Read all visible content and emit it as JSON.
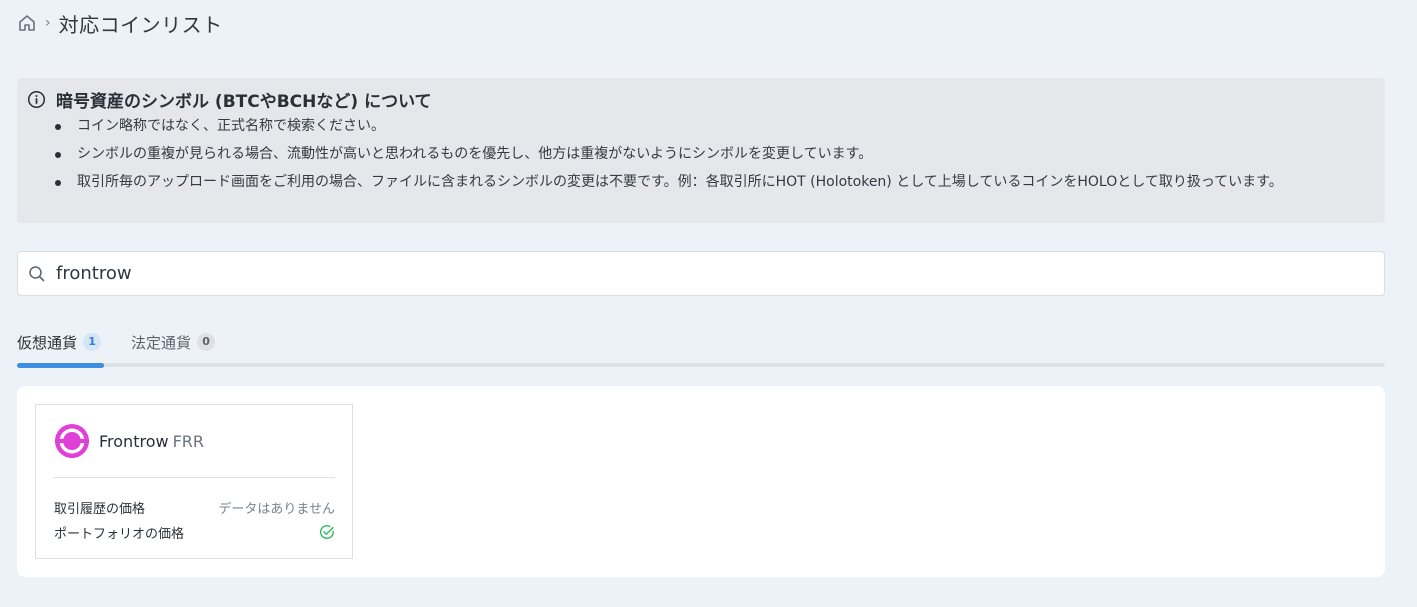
{
  "breadcrumb": {
    "home_icon": "home-icon",
    "separator": "›",
    "title": "対応コインリスト"
  },
  "info": {
    "icon": "info-icon",
    "title": "暗号資産のシンボル (BTCやBCHなど) について",
    "items": [
      "コイン略称ではなく、正式名称で検索ください。",
      "シンボルの重複が見られる場合、流動性が高いと思われるものを優先し、他方は重複がないようにシンボルを変更しています。",
      "取引所毎のアップロード画面をご利用の場合、ファイルに含まれるシンボルの変更は不要です。例：各取引所にHOT (Holotoken) として上場しているコインをHOLOとして取り扱っています。"
    ]
  },
  "search": {
    "icon": "search-icon",
    "value": "frontrow"
  },
  "tabs": [
    {
      "label": "仮想通貨",
      "count": "1",
      "active": true
    },
    {
      "label": "法定通貨",
      "count": "0",
      "active": false
    }
  ],
  "colors": {
    "background": "#edf2f8",
    "accent": "#3b8ee0",
    "coin_logo": "#e040d8",
    "success": "#2fb866"
  },
  "coin": {
    "logo_icon": "frontrow-logo-icon",
    "name": "Frontrow",
    "symbol": "FRR",
    "rows": [
      {
        "label": "取引履歴の価格",
        "value": "データはありません"
      },
      {
        "label": "ポートフォリオの価格",
        "value_icon": "check-circle-icon"
      }
    ]
  }
}
